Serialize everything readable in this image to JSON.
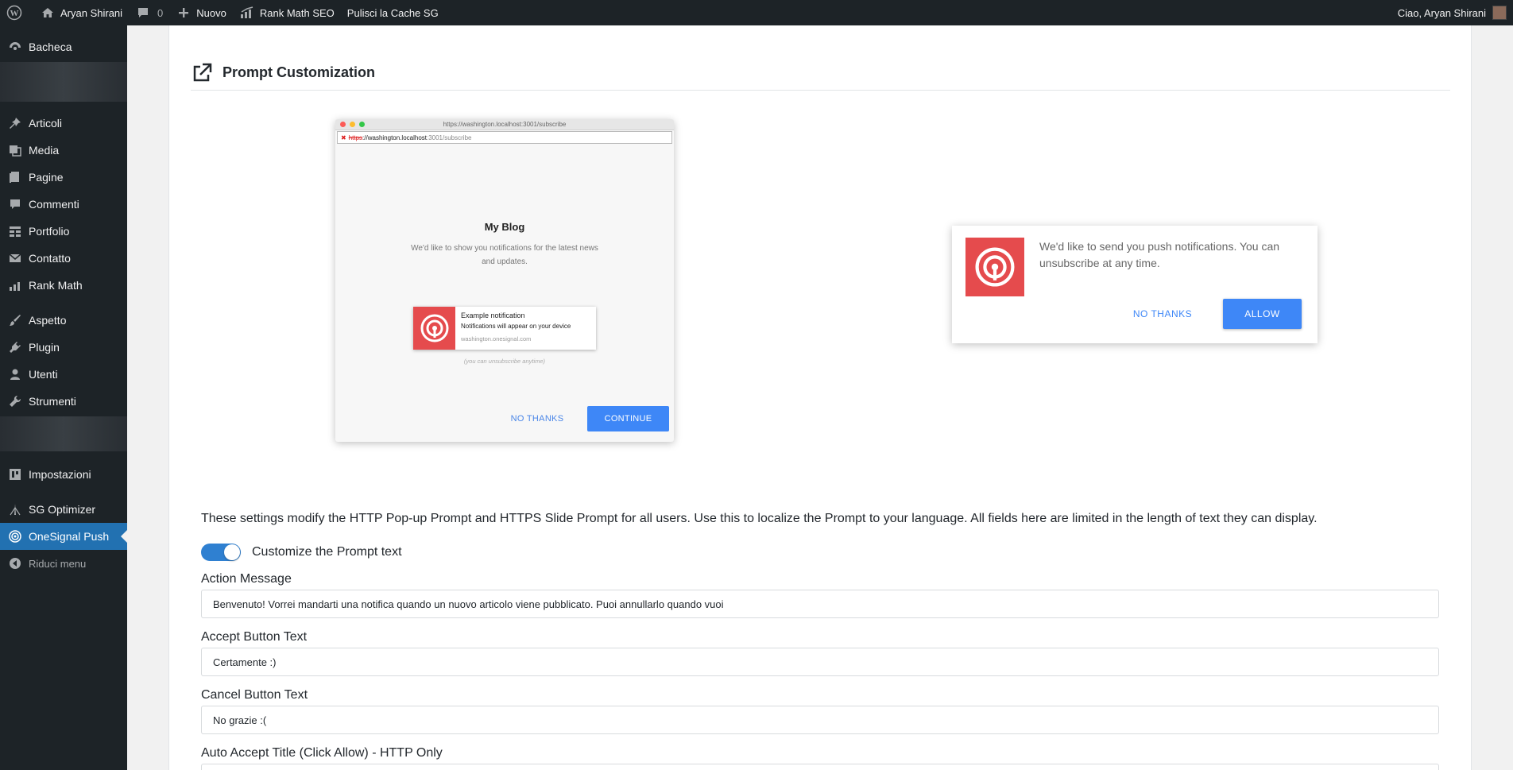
{
  "adminbar": {
    "site_name": "Aryan Shirani",
    "comments_count": "0",
    "new_label": "Nuovo",
    "rank_math_label": "Rank Math SEO",
    "cache_label": "Pulisci la Cache SG",
    "greeting": "Ciao, Aryan Shirani"
  },
  "sidebar": {
    "items": [
      {
        "label": "Bacheca",
        "icon": "dashboard-icon"
      },
      {
        "label": "Articoli",
        "icon": "pin-icon"
      },
      {
        "label": "Media",
        "icon": "media-icon"
      },
      {
        "label": "Pagine",
        "icon": "page-icon"
      },
      {
        "label": "Commenti",
        "icon": "comment-icon"
      },
      {
        "label": "Portfolio",
        "icon": "grid-icon"
      },
      {
        "label": "Contatto",
        "icon": "mail-icon"
      },
      {
        "label": "Rank Math",
        "icon": "chart-icon"
      },
      {
        "label": "Aspetto",
        "icon": "brush-icon"
      },
      {
        "label": "Plugin",
        "icon": "plug-icon"
      },
      {
        "label": "Utenti",
        "icon": "user-icon"
      },
      {
        "label": "Strumenti",
        "icon": "wrench-icon"
      },
      {
        "label": "Impostazioni",
        "icon": "settings-icon"
      },
      {
        "label": "SG Optimizer",
        "icon": "sg-icon"
      },
      {
        "label": "OneSignal Push",
        "icon": "onesignal-icon"
      },
      {
        "label": "Riduci menu",
        "icon": "collapse-icon"
      }
    ]
  },
  "section": {
    "title": "Prompt Customization"
  },
  "browser_mock": {
    "window_title": "https://washington.localhost:3001/subscribe",
    "url_scheme": "https",
    "url_host": "://washington.localhost",
    "url_path": ":3001/subscribe",
    "heading": "My Blog",
    "description": "We'd like to show you notifications for the latest news and updates.",
    "notif_title": "Example notification",
    "notif_body": "Notifications will appear on your device",
    "notif_site": "washington.onesignal.com",
    "unsubscribe_note": "(you can unsubscribe anytime)",
    "no_thanks": "NO THANKS",
    "continue": "CONTINUE"
  },
  "slide_mock": {
    "message": "We'd like to send you push notifications. You can unsubscribe at any time.",
    "no_thanks": "NO THANKS",
    "allow": "ALLOW"
  },
  "form": {
    "description": "These settings modify the HTTP Pop-up Prompt and HTTPS Slide Prompt for all users. Use this to localize the Prompt to your language. All fields here are limited in the length of text they can display.",
    "toggle_label": "Customize the Prompt text",
    "toggle_on": true,
    "action_message_label": "Action Message",
    "action_message_value": "Benvenuto! Vorrei mandarti una notifica quando un nuovo articolo viene pubblicato. Puoi annullarlo quando vuoi",
    "accept_label": "Accept Button Text",
    "accept_value": "Certamente :)",
    "cancel_label": "Cancel Button Text",
    "cancel_value": "No grazie :(",
    "auto_accept_label": "Auto Accept Title (Click Allow) - HTTP Only"
  },
  "colors": {
    "admin_dark": "#1d2327",
    "accent_blue": "#2271b1",
    "onesignal_red": "#e54b4d",
    "prompt_blue": "#3e87f7"
  }
}
